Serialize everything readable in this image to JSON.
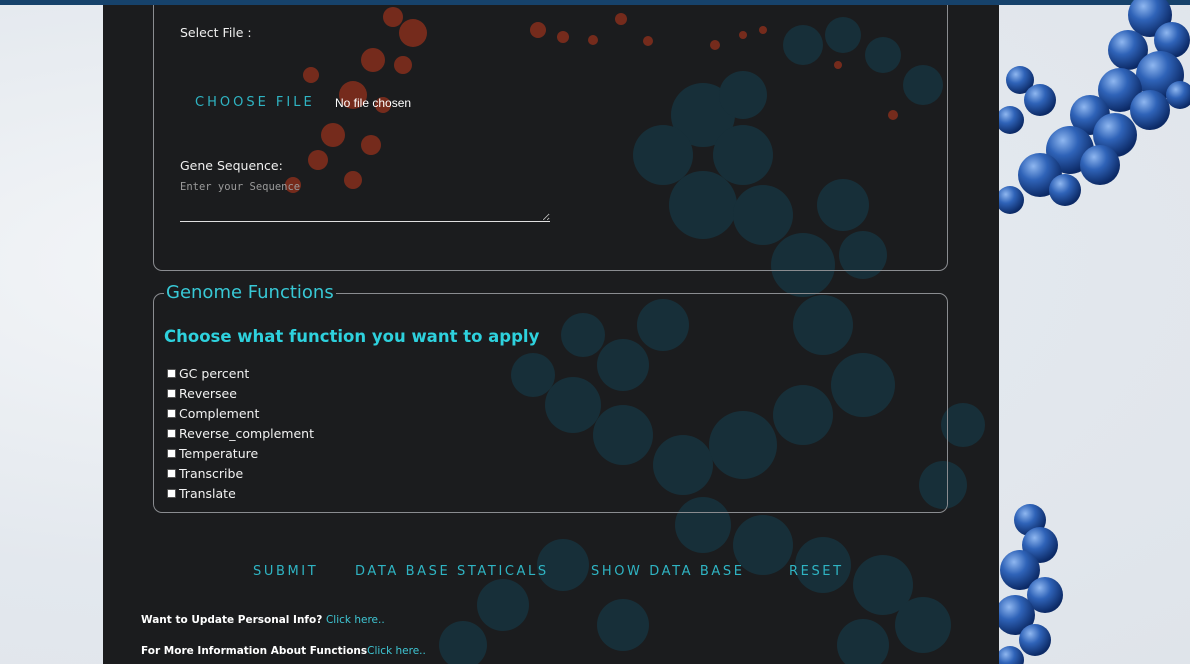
{
  "upload": {
    "select_file_label": "Select File :",
    "choose_file_label": "CHOOSE FILE",
    "no_file_text": "No file chosen",
    "gene_sequence_label": "Gene Sequence:",
    "sequence_placeholder": "Enter your Sequence"
  },
  "genome": {
    "legend": "Genome Functions",
    "heading": "Choose what function you want to apply",
    "options": [
      {
        "label": "GC percent",
        "checked": false
      },
      {
        "label": "Reversee",
        "checked": false
      },
      {
        "label": "Complement",
        "checked": false
      },
      {
        "label": "Reverse_complement",
        "checked": false
      },
      {
        "label": "Temperature",
        "checked": false
      },
      {
        "label": "Transcribe",
        "checked": false
      },
      {
        "label": "Translate",
        "checked": false
      }
    ]
  },
  "actions": {
    "submit": "SUBMIT",
    "db_stats": "DATA BASE STATICALS",
    "show_db": "SHOW DATA BASE",
    "reset": "RESET"
  },
  "footer": {
    "update_text": "Want to Update Personal Info?",
    "update_link": "Click here..",
    "info_text": "For More Information About Functions",
    "info_link": "Click here.."
  },
  "colors": {
    "accent": "#2fb4c3",
    "heading": "#2ed1dd",
    "panel_bg": "#1b1c1e",
    "top_bar": "#16426b"
  }
}
